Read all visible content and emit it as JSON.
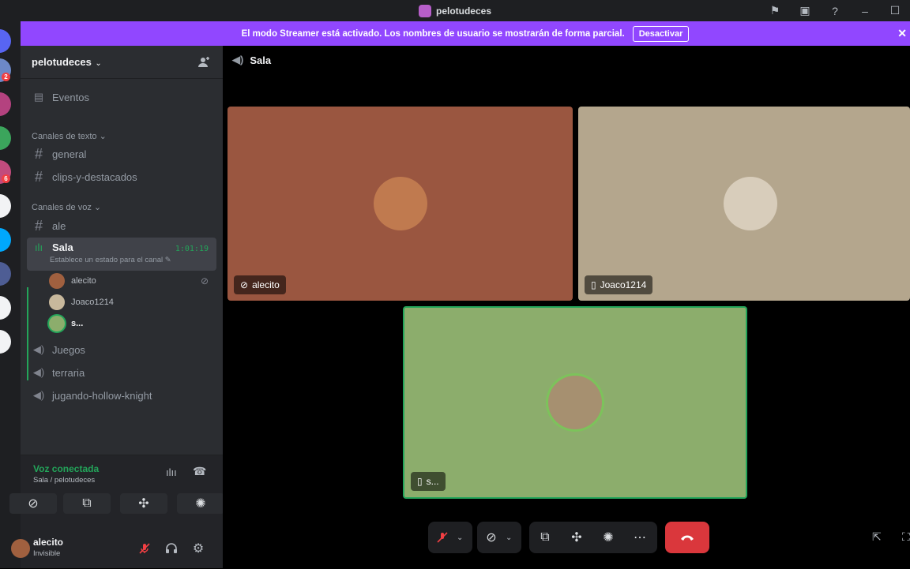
{
  "window": {
    "title": "pelotudeces"
  },
  "banner": {
    "text": "El modo Streamer está activado. Los nombres de usuario se mostrarán de forma parcial.",
    "button": "Desactivar"
  },
  "server": {
    "name": "pelotudeces"
  },
  "rail_badges": [
    "2",
    "6"
  ],
  "channels": {
    "events": "Eventos",
    "text_category": "Canales de texto",
    "text": [
      "general",
      "clips-y-destacados"
    ],
    "voice_category": "Canales de voz",
    "voice_text": "ale",
    "active": {
      "name": "Sala",
      "status": "Establece un estado para el canal",
      "time": "1:01:19"
    },
    "voice_users": [
      "alecito",
      "Joaco1214",
      "s..."
    ],
    "voice_other": [
      "Juegos",
      "terraria",
      "jugando-hollow-knight"
    ]
  },
  "voice_panel": {
    "status": "Voz conectada",
    "location": "Sala / pelotudeces"
  },
  "user": {
    "name": "alecito",
    "status": "Invisible"
  },
  "call": {
    "channel": "Sala",
    "tiles": [
      {
        "name": "alecito",
        "bg": "#9a5640"
      },
      {
        "name": "Joaco1214",
        "bg": "#b4a68d"
      },
      {
        "name": "s...",
        "bg": "#8cad6c"
      }
    ]
  },
  "colors": {
    "accent": "#9147ff",
    "speaking": "#23a55a",
    "danger": "#da373c"
  }
}
